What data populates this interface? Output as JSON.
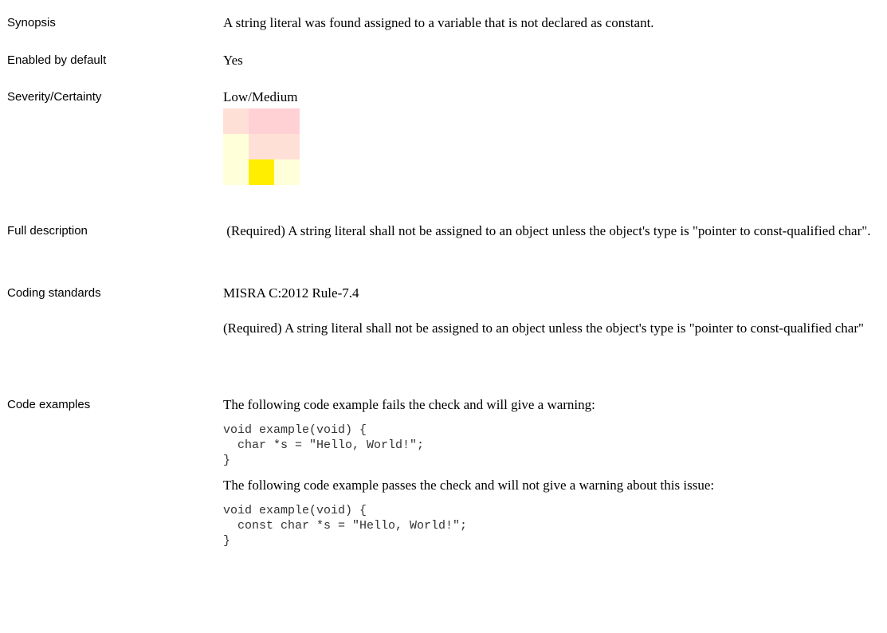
{
  "synopsis": {
    "label": "Synopsis",
    "text": "A string literal was found assigned to a variable that is not declared as constant."
  },
  "enabled": {
    "label": "Enabled by default",
    "text": "Yes"
  },
  "severity": {
    "label": "Severity/Certainty",
    "text": "Low/Medium",
    "matrix_colors": [
      [
        "#ffe0d6",
        "#ffd0d4",
        "#ffd0d4"
      ],
      [
        "#ffffd9",
        "#ffe0d6",
        "#ffe0d6"
      ],
      [
        "#ffffd9",
        "#ffee00",
        "#ffffd9"
      ]
    ],
    "highlighted_cell": {
      "row": 3,
      "column": 2
    }
  },
  "full_description": {
    "label": "Full description",
    "text": " (Required) A string literal shall not be assigned to an object unless the object's type is \"pointer to const-qualified char\"."
  },
  "coding_standards": {
    "label": "Coding standards",
    "standard": "MISRA C:2012 Rule-7.4",
    "text": "(Required) A string literal shall not be assigned to an object unless the object's type is \"pointer to const-qualified char\""
  },
  "code_examples": {
    "label": "Code examples",
    "fail_intro": "The following code example fails the check and will give a warning:",
    "fail_code": "void example(void) {\n  char *s = \"Hello, World!\";\n}",
    "pass_intro": "The following code example passes the check and will not give a warning about this issue:",
    "pass_code": "void example(void) {\n  const char *s = \"Hello, World!\";\n}"
  }
}
